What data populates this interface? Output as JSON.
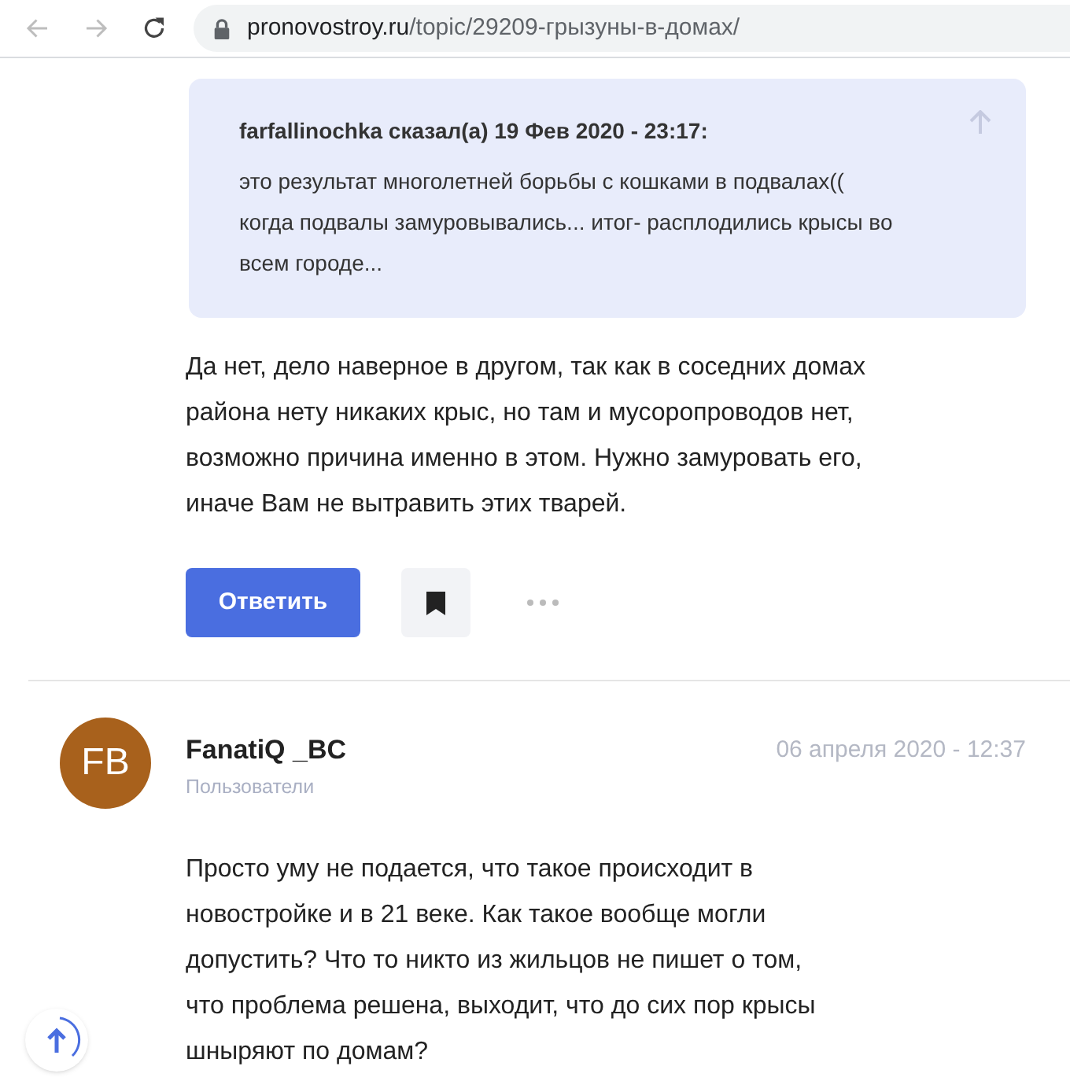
{
  "browser": {
    "url_host": "pronovostroy.ru",
    "url_path": "/topic/29209-грызуны-в-домах/"
  },
  "quote": {
    "header": "farfallinochka сказал(а) 19 Фев 2020 - 23:17:",
    "text": "это результат многолетней борьбы с кошками в подвалах(( когда подвалы замуровывались... итог- расплодились крысы во всем городе..."
  },
  "reply_text": "Да нет, дело наверное в другом, так как в соседних домах района нету никаких крыс, но там и мусоропроводов нет, возможно причина именно в этом. Нужно замуровать его, иначе Вам не вытравить этих тварей.",
  "actions": {
    "reply_button": "Ответить"
  },
  "post": {
    "avatar_initials": "FB",
    "author": "FanatiQ _BC",
    "group": "Пользователи",
    "date": "06 апреля 2020 - 12:37",
    "text": "Просто уму не подается, что такое происходит в новостройке и в 21 веке. Как такое вообще могли допустить? Что то никто из жильцов не пишет о том, что проблема решена, выходит, что до сих пор крысы шныряют по домам?"
  }
}
